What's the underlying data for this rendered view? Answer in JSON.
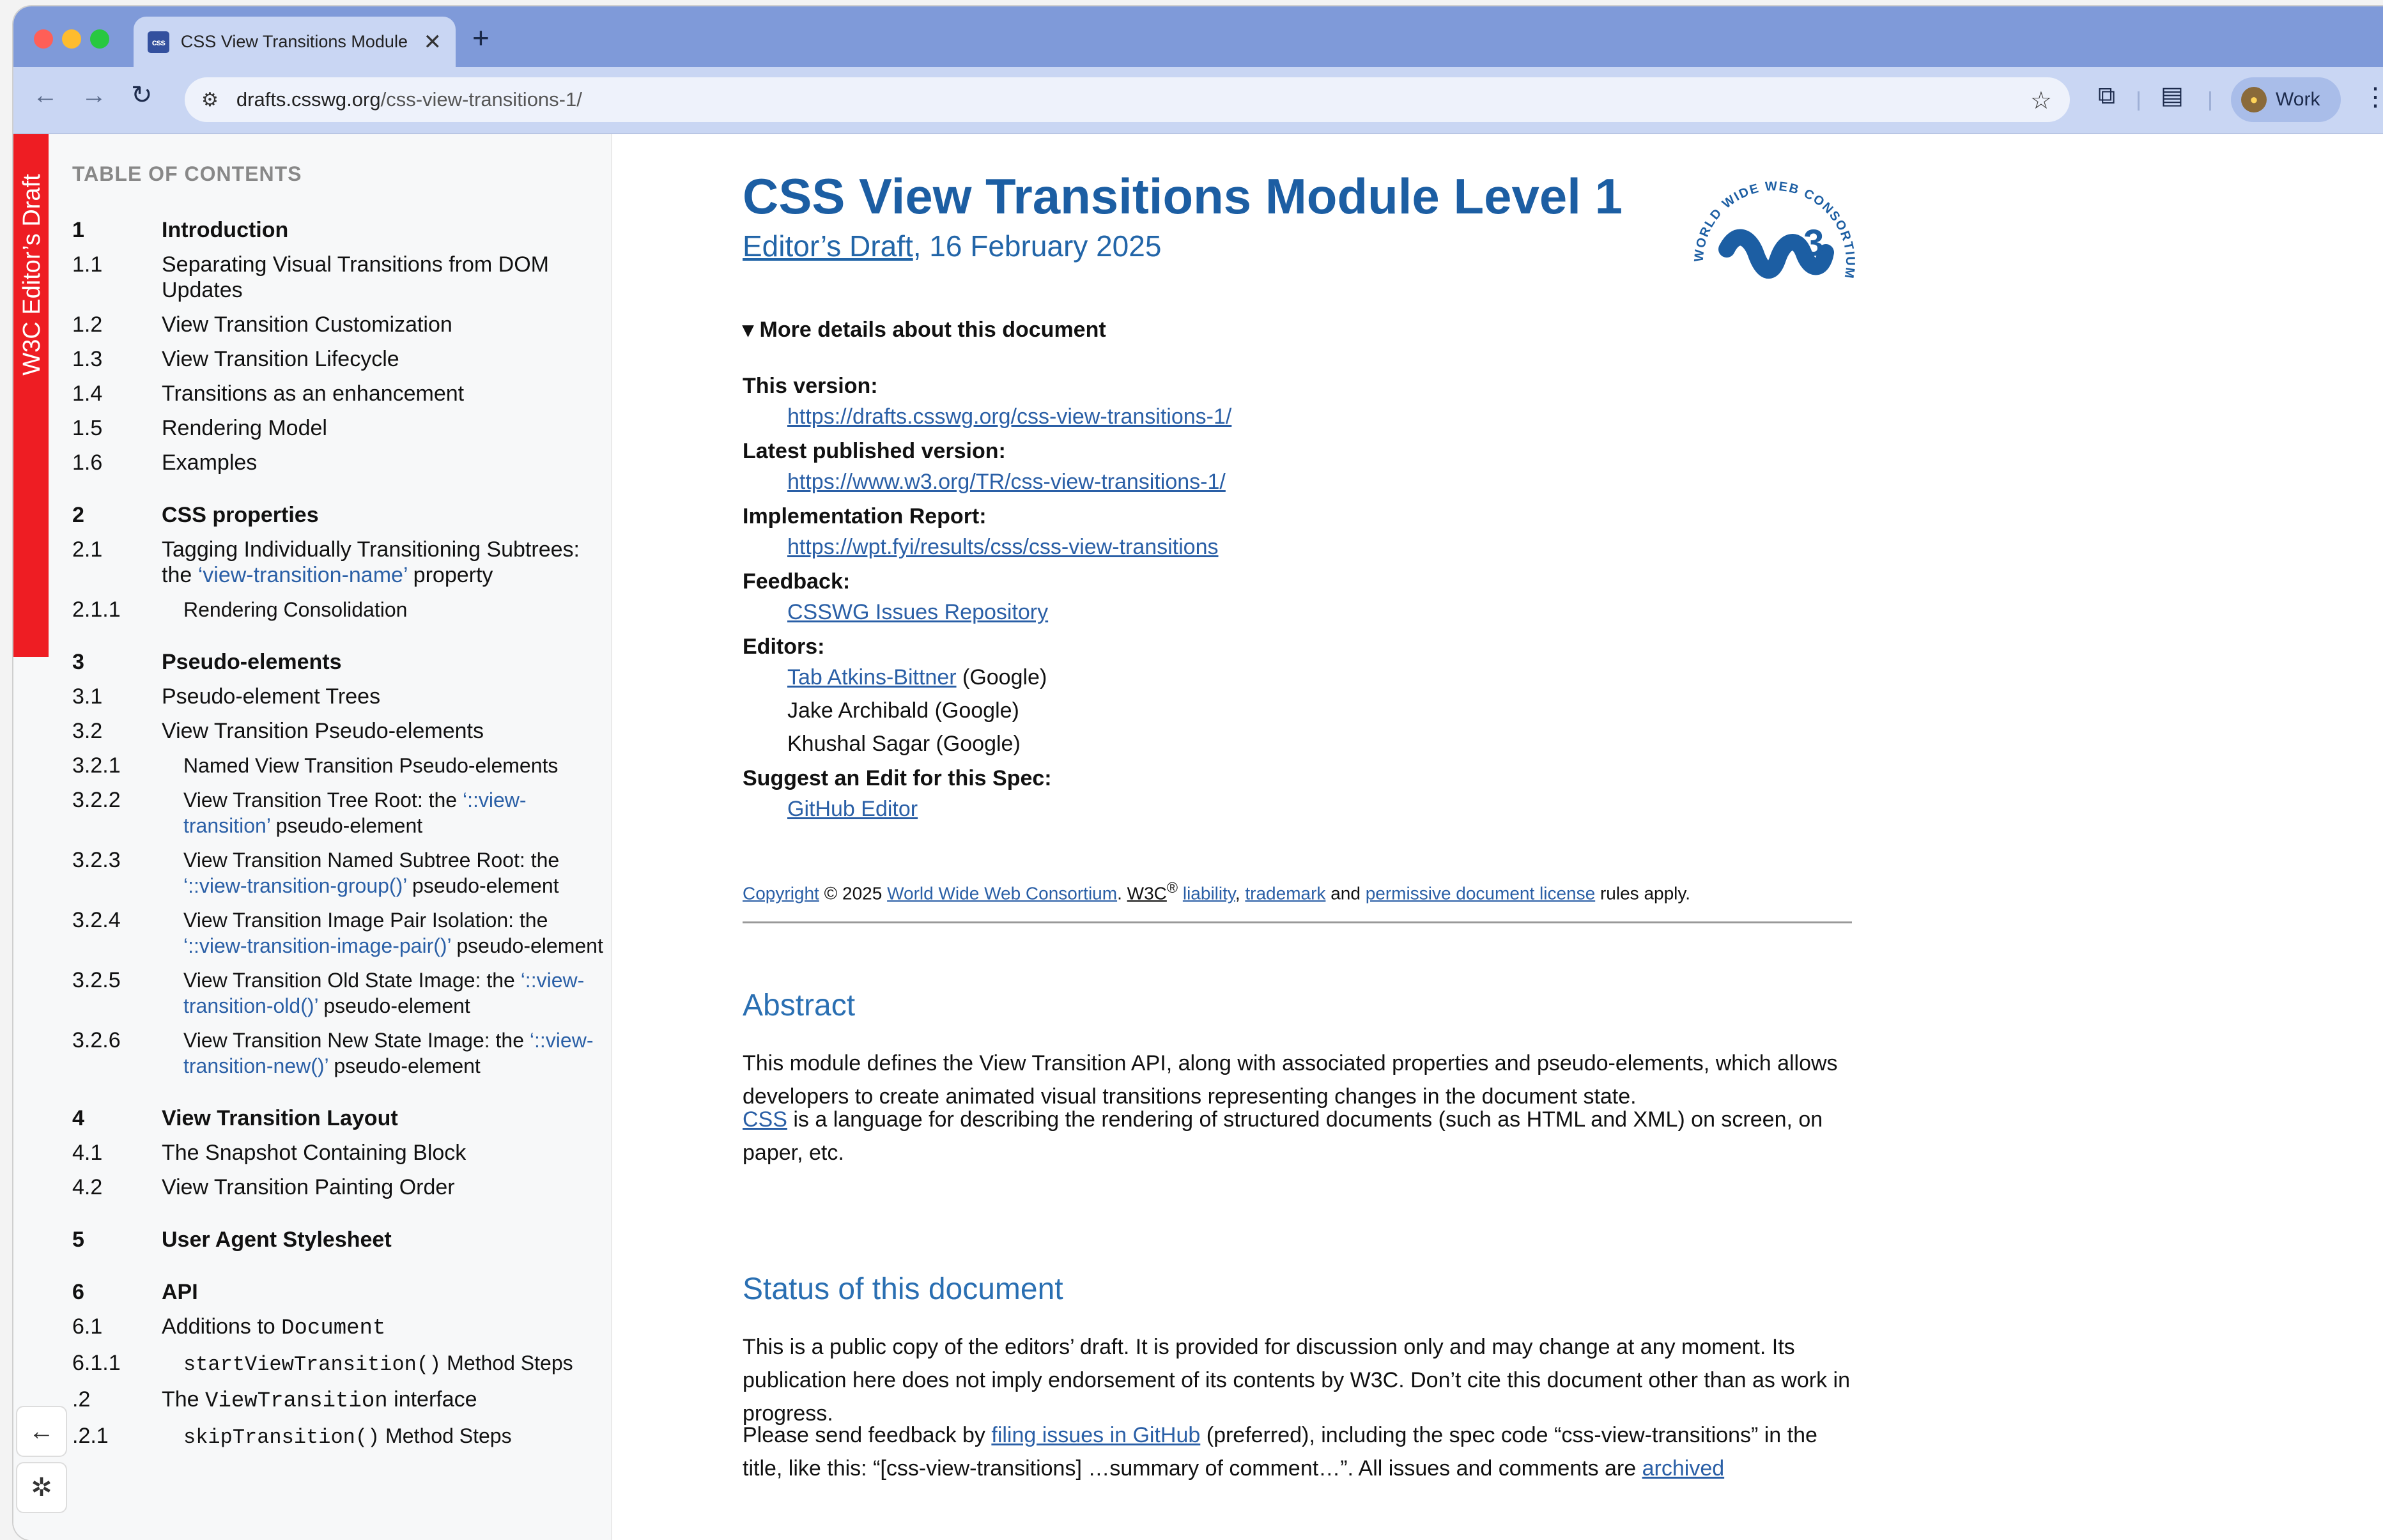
{
  "browser": {
    "tab_title": "CSS View Transitions Module",
    "tab_favicon": "css",
    "new_tab": "+",
    "url_domain": "drafts.csswg.org",
    "url_path": "/css-view-transitions-1/",
    "profile_label": "Work"
  },
  "sidebar": {
    "banner": "W3C Editor’s Draft",
    "toc_title": "TABLE OF CONTENTS",
    "toc": [
      {
        "num": "1",
        "text": "Introduction"
      },
      {
        "num": "1.1",
        "text": "Separating Visual Transitions from DOM Updates"
      },
      {
        "num": "1.2",
        "text": "View Transition Customization"
      },
      {
        "num": "1.3",
        "text": "View Transition Lifecycle"
      },
      {
        "num": "1.4",
        "text": "Transitions as an enhancement"
      },
      {
        "num": "1.5",
        "text": "Rendering Model"
      },
      {
        "num": "1.6",
        "text": "Examples"
      },
      {
        "num": "2",
        "text": "CSS properties"
      },
      {
        "num": "2.1",
        "text_a": "Tagging Individually Transitioning Subtrees: the ",
        "link": "‘view-transition-name’",
        "text_b": " property"
      },
      {
        "num": "2.1.1",
        "text": "Rendering Consolidation"
      },
      {
        "num": "3",
        "text": "Pseudo-elements"
      },
      {
        "num": "3.1",
        "text": "Pseudo-element Trees"
      },
      {
        "num": "3.2",
        "text": "View Transition Pseudo-elements"
      },
      {
        "num": "3.2.1",
        "text": "Named View Transition Pseudo-elements"
      },
      {
        "num": "3.2.2",
        "text_a": "View Transition Tree Root: the ",
        "link": "‘::view-transition’",
        "text_b": " pseudo-element"
      },
      {
        "num": "3.2.3",
        "text_a": "View Transition Named Subtree Root: the ",
        "link": "‘::view-transition-group()’",
        "text_b": " pseudo-element"
      },
      {
        "num": "3.2.4",
        "text_a": "View Transition Image Pair Isolation: the ",
        "link": "‘::view-transition-image-pair()’",
        "text_b": " pseudo-element"
      },
      {
        "num": "3.2.5",
        "text_a": "View Transition Old State Image: the ",
        "link": "‘::view-transition-old()’",
        "text_b": " pseudo-element"
      },
      {
        "num": "3.2.6",
        "text_a": "View Transition New State Image: the ",
        "link": "‘::view-transition-new()’",
        "text_b": " pseudo-element"
      },
      {
        "num": "4",
        "text": "View Transition Layout"
      },
      {
        "num": "4.1",
        "text": "The Snapshot Containing Block"
      },
      {
        "num": "4.2",
        "text": "View Transition Painting Order"
      },
      {
        "num": "5",
        "text": "User Agent Stylesheet"
      },
      {
        "num": "6",
        "text": "API"
      },
      {
        "num": "6.1",
        "text_a": "Additions to ",
        "mono": "Document"
      },
      {
        "num": "6.1.1",
        "mono": "startViewTransition()",
        "text_b": " Method Steps"
      },
      {
        "num": ".2",
        "text_a": "The ",
        "mono": "ViewTransition",
        "text_b": " interface"
      },
      {
        "num": ".2.1",
        "mono": "skipTransition()",
        "text_b": " Method Steps"
      }
    ]
  },
  "doc": {
    "title": "CSS View Transitions Module Level 1",
    "status_link": "Editor’s Draft",
    "date": ", 16 February 2025",
    "details_summary": "▾ More details about this document",
    "this_version_label": "This version:",
    "this_version_url": "https://drafts.csswg.org/css-view-transitions-1/",
    "latest_label": "Latest published version:",
    "latest_url": "https://www.w3.org/TR/css-view-transitions-1/",
    "impl_label": "Implementation Report:",
    "impl_url": "https://wpt.fyi/results/css/css-view-transitions",
    "feedback_label": "Feedback:",
    "feedback_link": "CSSWG Issues Repository",
    "editors_label": "Editors:",
    "editor1_link": "Tab Atkins-Bittner",
    "editor1_org": " (Google)",
    "editor2": "Jake Archibald (Google)",
    "editor3": "Khushal Sagar (Google)",
    "suggest_label": "Suggest an Edit for this Spec:",
    "suggest_link": "GitHub Editor",
    "copyright": {
      "link1": "Copyright",
      "text1": " © 2025 ",
      "link2": "World Wide Web Consortium",
      "text2": ". ",
      "w3c": "W3C",
      "reg": "®",
      "text3": " ",
      "link3": "liability",
      "text4": ", ",
      "link4": "trademark",
      "text5": " and ",
      "link5": "permissive document license",
      "text6": " rules apply."
    },
    "abstract_heading": "Abstract",
    "abstract_p1": "This module defines the View Transition API, along with associated properties and pseudo-elements, which allows developers to create animated visual transitions representing changes in the document state.",
    "abstract_p2_link": "CSS",
    "abstract_p2": " is a language for describing the rendering of structured documents (such as HTML and XML) on screen, on paper, etc.",
    "status_heading": "Status of this document",
    "status_p1": "This is a public copy of the editors’ draft. It is provided for discussion only and may change at any moment. Its publication here does not imply endorsement of its contents by W3C. Don’t cite this document other than as work in progress.",
    "status_p2_a": "Please send feedback by ",
    "status_p2_link": "filing issues in GitHub",
    "status_p2_b": " (preferred), including the spec code “css-view-transitions” in the title, like this: “[css-view-transitions] …summary of comment…”. All issues and comments are ",
    "status_p2_link2": "archived"
  },
  "logo": {
    "ring_text": "WORLD WIDE WEB CONSORTIUM",
    "mark": "W3"
  },
  "colors": {
    "tabstrip": "#7f9ad9",
    "toolbar": "#c9d6f3",
    "banner_red": "#ee1d23",
    "title_blue": "#1c5ea3",
    "link_blue": "#2a5fa6"
  },
  "icons": [
    "back-arrow-icon",
    "forward-arrow-icon",
    "reload-icon",
    "site-info-icon",
    "star-icon",
    "extensions-icon",
    "reading-mode-icon",
    "menu-icon",
    "collapse-sidebar-icon",
    "sidebar-settings-icon"
  ]
}
